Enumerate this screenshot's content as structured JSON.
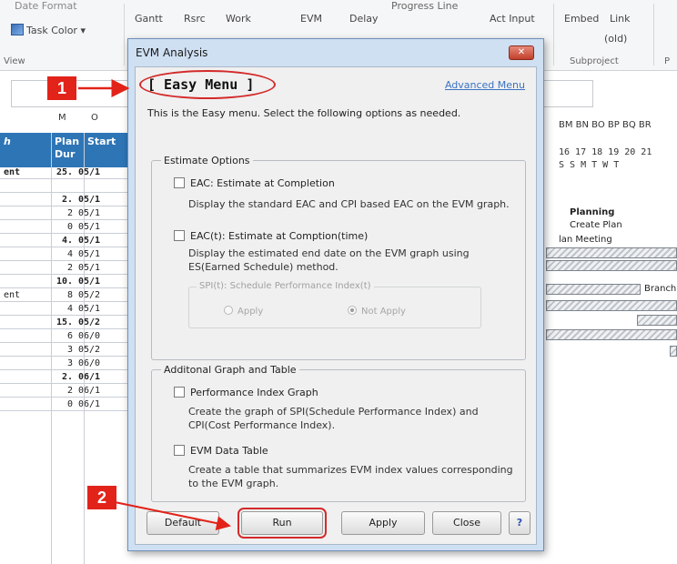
{
  "ribbon": {
    "date_format": "Date Format",
    "task_color": "Task Color",
    "view_group": "View",
    "gantt": "Gantt",
    "rsrc": "Rsrc",
    "work": "Work",
    "evm": "EVM",
    "delay": "Delay",
    "progress_line": "Progress Line",
    "act_input": "Act Input",
    "embed": "Embed",
    "link": "Link",
    "link_sub": "(old)",
    "subproject_group": "Subproject",
    "p_group": "P"
  },
  "sheet": {
    "col_letters": [
      "M",
      "O"
    ],
    "headers": {
      "c1": "h",
      "c2": "Plan Dur",
      "c3": "Start"
    },
    "rows": [
      {
        "c1": "ent",
        "c2": "25.",
        "c3": "05/1",
        "bold": true
      },
      {
        "c1": "",
        "c2": "",
        "c3": "",
        "bold": false
      },
      {
        "c1": "",
        "c2": "2.",
        "c3": "05/1",
        "bold": true
      },
      {
        "c1": "",
        "c2": "2",
        "c3": "05/1",
        "bold": false
      },
      {
        "c1": "",
        "c2": "0",
        "c3": "05/1",
        "bold": false
      },
      {
        "c1": "",
        "c2": "4.",
        "c3": "05/1",
        "bold": true
      },
      {
        "c1": "",
        "c2": "4",
        "c3": "05/1",
        "bold": false
      },
      {
        "c1": "",
        "c2": "2",
        "c3": "05/1",
        "bold": false
      },
      {
        "c1": "",
        "c2": "10.",
        "c3": "05/1",
        "bold": true
      },
      {
        "c1": "ent",
        "c2": "8",
        "c3": "05/2",
        "bold": false
      },
      {
        "c1": "",
        "c2": "4",
        "c3": "05/1",
        "bold": false
      },
      {
        "c1": "",
        "c2": "15.",
        "c3": "05/2",
        "bold": true
      },
      {
        "c1": "",
        "c2": "6",
        "c3": "06/0",
        "bold": false
      },
      {
        "c1": "",
        "c2": "3",
        "c3": "05/2",
        "bold": false
      },
      {
        "c1": "",
        "c2": "3",
        "c3": "06/0",
        "bold": false
      },
      {
        "c1": "",
        "c2": "2.",
        "c3": "06/1",
        "bold": true
      },
      {
        "c1": "",
        "c2": "2",
        "c3": "06/1",
        "bold": false
      },
      {
        "c1": "",
        "c2": "0",
        "c3": "06/1",
        "bold": false
      }
    ]
  },
  "gantt": {
    "col_letters": "BM BN BO BP BQ BR",
    "days": "16 17 18 19 20 21",
    "weekdays": "S  S  M  T  W  T",
    "planning": "Planning",
    "create_plan": "Create Plan",
    "plan_meeting": "lan Meeting",
    "branch": "Branch"
  },
  "dialog": {
    "title": "EVM Analysis",
    "close_glyph": "✕",
    "menu_title": "[ Easy Menu ]",
    "advanced_link": "Advanced Menu",
    "intro": "This is the Easy menu. Select the following options as needed.",
    "estimate_section": "Estimate Options",
    "eac_label": "EAC: Estimate at Completion",
    "eac_desc": "Display the standard EAC and CPI based EAC on the EVM graph.",
    "eact_label": "EAC(t): Estimate at Comption(time)",
    "eact_desc": "Display the estimated end date on the EVM graph using ES(Earned Schedule) method.",
    "spi_group": "SPI(t): Schedule Performance Index(t)",
    "radio_apply": "Apply",
    "radio_not_apply": "Not Apply",
    "additional_section": "Additonal Graph and Table",
    "pig_label": "Performance Index Graph",
    "pig_desc": "Create the graph of SPI(Schedule Performance Index) and CPI(Cost Performance Index).",
    "table_label": "EVM Data Table",
    "table_desc": "Create a table that summarizes EVM index values corresponding to the EVM graph.",
    "buttons": {
      "default": "Default",
      "run": "Run",
      "apply": "Apply",
      "close": "Close",
      "help": "?"
    }
  },
  "annotations": {
    "step1": "1",
    "step2": "2",
    "color": "#e2231a"
  }
}
